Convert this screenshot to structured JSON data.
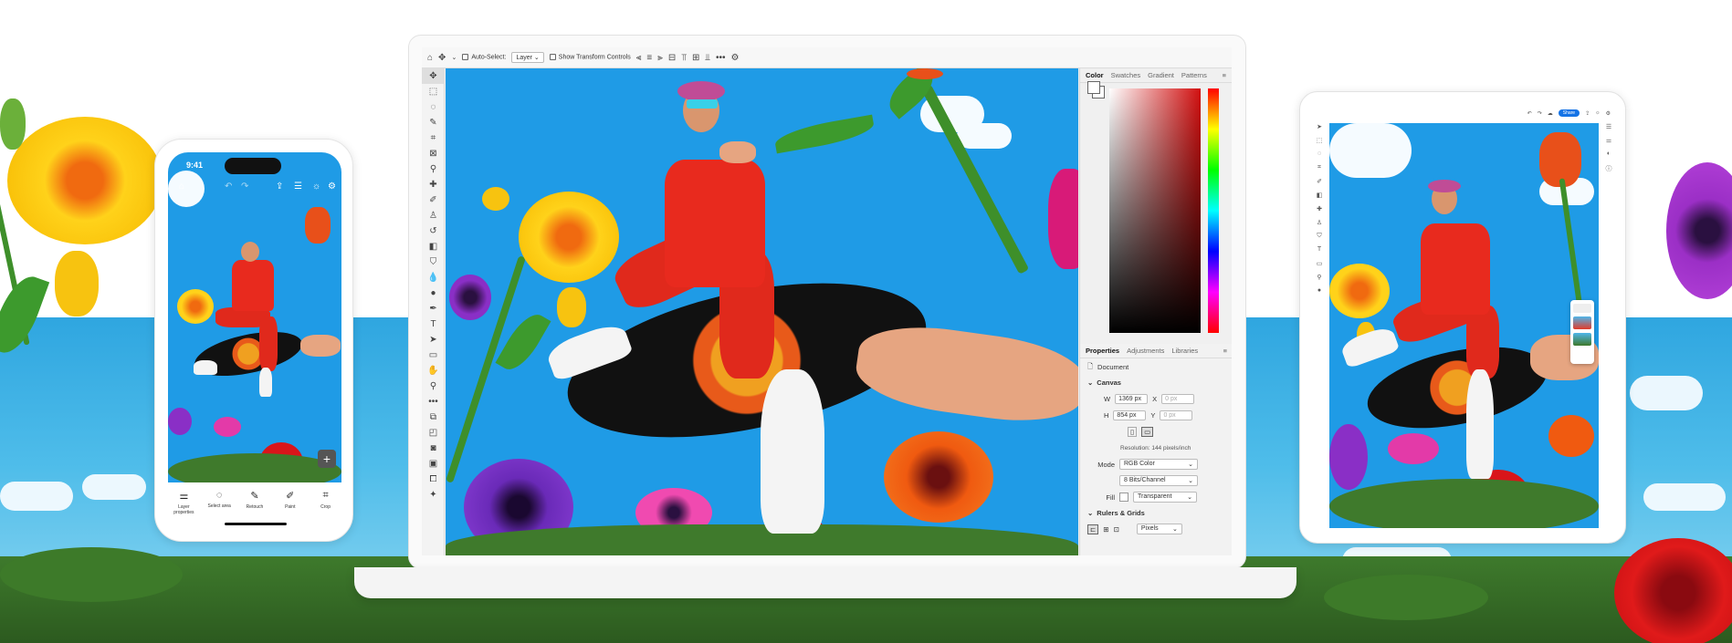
{
  "photoshop": {
    "options_bar": {
      "auto_select_label": "Auto-Select:",
      "auto_select_value": "Layer",
      "transform_label": "Show Transform Controls"
    },
    "color_panel": {
      "tabs": [
        "Color",
        "Swatches",
        "Gradient",
        "Patterns"
      ]
    },
    "properties_panel": {
      "tabs": [
        "Properties",
        "Adjustments",
        "Libraries"
      ],
      "document_label": "Document",
      "canvas_header": "Canvas",
      "w_label": "W",
      "w_value": "1369 px",
      "h_label": "H",
      "h_value": "854 px",
      "x_label": "X",
      "x_value": "0 px",
      "y_label": "Y",
      "y_value": "0 px",
      "resolution": "Resolution: 144 pixels/inch",
      "mode_label": "Mode",
      "mode_value": "RGB Color",
      "bits_value": "8 Bits/Channel",
      "fill_label": "Fill",
      "fill_value": "Transparent",
      "rulers_header": "Rulers & Grids",
      "units_value": "Pixels"
    }
  },
  "phone": {
    "time": "9:41",
    "tools": [
      {
        "label": "Layer properties",
        "icon": "sliders-icon"
      },
      {
        "label": "Select area",
        "icon": "lasso-icon"
      },
      {
        "label": "Retouch",
        "icon": "bandage-icon"
      },
      {
        "label": "Paint",
        "icon": "brush-icon"
      },
      {
        "label": "Crop",
        "icon": "crop-icon"
      }
    ]
  },
  "tablet": {
    "share_label": "Share"
  },
  "colors": {
    "sky": "#1f9be6",
    "accent_blue": "#1473e6",
    "suit_red": "#e82a1e"
  }
}
